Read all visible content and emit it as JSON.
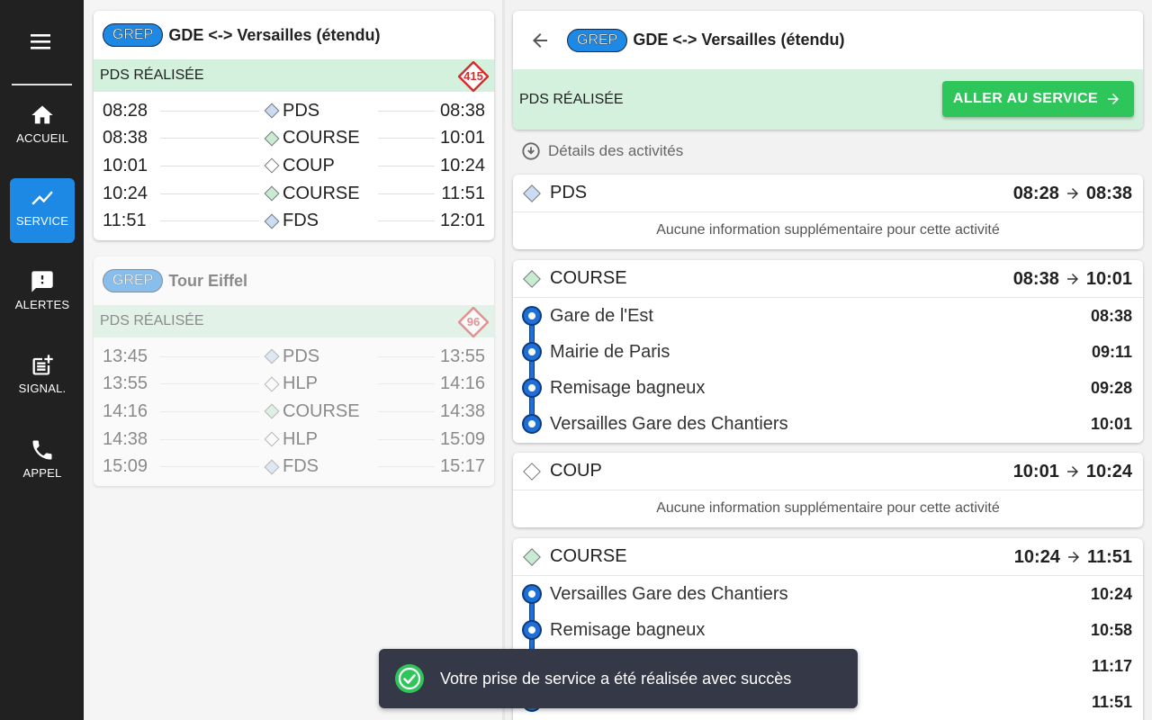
{
  "sidebar": {
    "items": [
      {
        "label": "ACCUEIL",
        "icon": "home-icon"
      },
      {
        "label": "SERVICE",
        "icon": "trending-icon"
      },
      {
        "label": "ALERTES",
        "icon": "alert-icon"
      },
      {
        "label": "SIGNAL.",
        "icon": "post-add-icon"
      },
      {
        "label": "APPEL",
        "icon": "phone-icon"
      }
    ],
    "active": "SERVICE"
  },
  "services": [
    {
      "badge": "GREP",
      "title": "GDE <-> Versailles (étendu)",
      "status": "PDS RÉALISÉE",
      "number": "415",
      "activities": [
        {
          "start": "08:28",
          "code": "PDS",
          "end": "08:38",
          "color": "#c9dcf2"
        },
        {
          "start": "08:38",
          "code": "COURSE",
          "end": "10:01",
          "color": "#c8ecd2"
        },
        {
          "start": "10:01",
          "code": "COUP",
          "end": "10:24",
          "color": "#ffffff"
        },
        {
          "start": "10:24",
          "code": "COURSE",
          "end": "11:51",
          "color": "#c8ecd2"
        },
        {
          "start": "11:51",
          "code": "FDS",
          "end": "12:01",
          "color": "#c9dcf2"
        }
      ]
    },
    {
      "badge": "GREP",
      "title": "Tour Eiffel",
      "status": "PDS RÉALISÉE",
      "number": "96",
      "activities": [
        {
          "start": "13:45",
          "code": "PDS",
          "end": "13:55",
          "color": "#c9dcf2"
        },
        {
          "start": "13:55",
          "code": "HLP",
          "end": "14:16",
          "color": "#ffffff"
        },
        {
          "start": "14:16",
          "code": "COURSE",
          "end": "14:38",
          "color": "#c8ecd2"
        },
        {
          "start": "14:38",
          "code": "HLP",
          "end": "15:09",
          "color": "#ffffff"
        },
        {
          "start": "15:09",
          "code": "FDS",
          "end": "15:17",
          "color": "#c9dcf2"
        }
      ]
    }
  ],
  "detail": {
    "badge": "GREP",
    "title": "GDE <-> Versailles (étendu)",
    "status": "PDS RÉALISÉE",
    "go_button": "ALLER AU SERVICE",
    "details_label": "Détails des activités",
    "activities": [
      {
        "code": "PDS",
        "start": "08:28",
        "end": "08:38",
        "info": "Aucune information supplémentaire pour cette activité"
      },
      {
        "code": "COURSE",
        "start": "08:38",
        "end": "10:01",
        "stops": [
          {
            "name": "Gare de l'Est",
            "time": "08:38"
          },
          {
            "name": "Mairie de Paris",
            "time": "09:11"
          },
          {
            "name": "Remisage bagneux",
            "time": "09:28"
          },
          {
            "name": "Versailles Gare des Chantiers",
            "time": "10:01"
          }
        ]
      },
      {
        "code": "COUP",
        "start": "10:01",
        "end": "10:24",
        "info": "Aucune information supplémentaire pour cette activité"
      },
      {
        "code": "COURSE",
        "start": "10:24",
        "end": "11:51",
        "stops": [
          {
            "name": "Versailles Gare des Chantiers",
            "time": "10:24"
          },
          {
            "name": "Remisage bagneux",
            "time": "10:58"
          },
          {
            "name": "",
            "time": "11:17"
          },
          {
            "name": "",
            "time": "11:51"
          }
        ]
      }
    ]
  },
  "toast": {
    "message": "Votre prise de service a été réalisée avec succès"
  }
}
